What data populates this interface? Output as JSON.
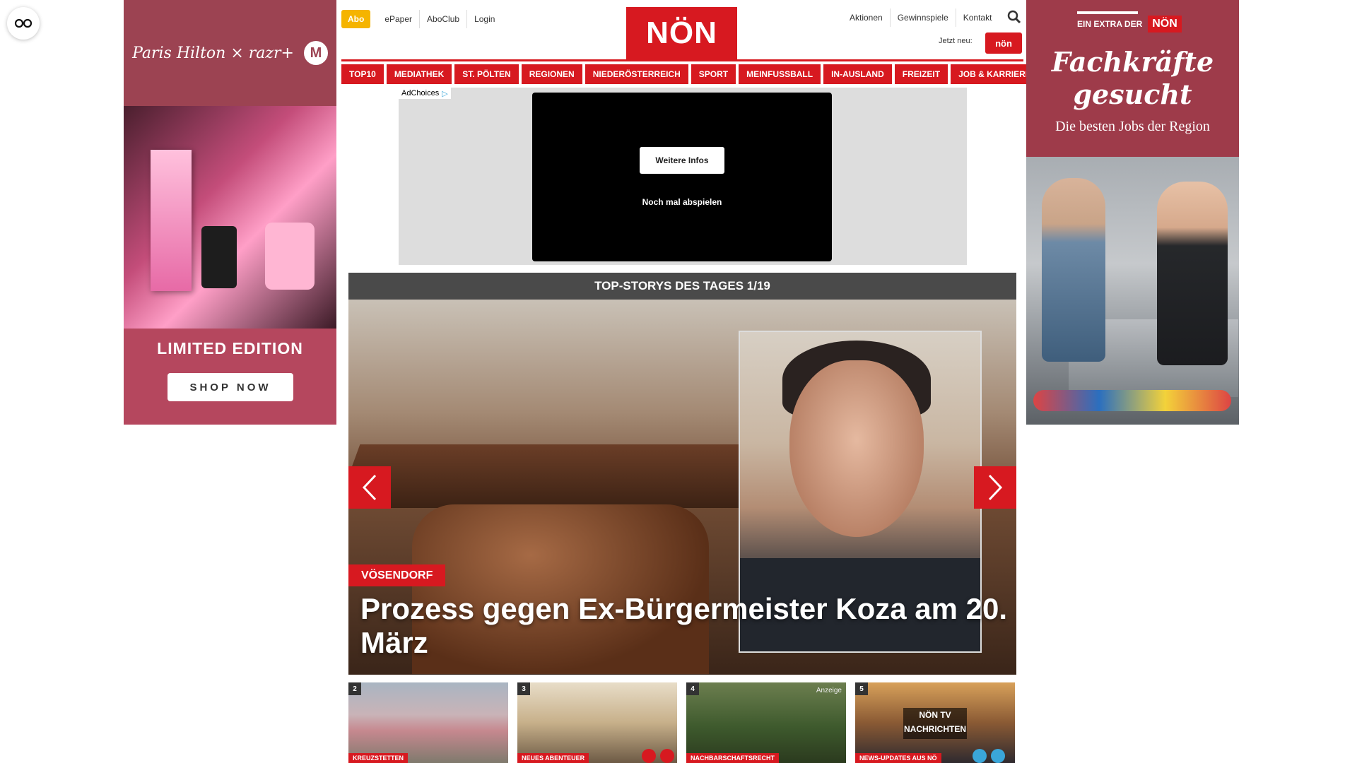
{
  "colors": {
    "brand_red": "#d71920",
    "abo_yellow": "#f5b400",
    "dark_header": "#4a4a4a"
  },
  "privacy_button": {
    "icon": "glasses-icon"
  },
  "ad_left": {
    "brand_text": "Paris Hilton × razr+",
    "headline": "LIMITED EDITION",
    "cta": "SHOP NOW"
  },
  "header": {
    "logo": "NÖN",
    "left_links": {
      "abo": "Abo",
      "epaper": "ePaper",
      "aboclub": "AboClub",
      "login": "Login"
    },
    "right_links": {
      "aktionen": "Aktionen",
      "gewinnspiele": "Gewinnspiele",
      "kontakt": "Kontakt"
    },
    "jetzt_neu": "Jetzt neu:",
    "meinenoen": "nön"
  },
  "nav": {
    "items": [
      "TOP10",
      "MEDIATHEK",
      "ST. PÖLTEN",
      "REGIONEN",
      "NIEDERÖSTERREICH",
      "SPORT",
      "MEINFUSSBALL",
      "IN-AUSLAND",
      "FREIZEIT",
      "JOB & KARRIERE"
    ]
  },
  "video_ad": {
    "adchoices": "AdChoices",
    "more_info": "Weitere Infos",
    "replay": "Noch mal abspielen"
  },
  "top_stories": {
    "heading": "TOP-STORYS DES TAGES 1/19",
    "hero": {
      "tag": "VÖSENDORF",
      "title": "Prozess gegen Ex-Bürgermeister Koza am 20. März"
    },
    "thumbs": [
      {
        "num": "2",
        "tag": "KREUZSTETTEN"
      },
      {
        "num": "3",
        "tag": "NEUES ABENTEUER"
      },
      {
        "num": "4",
        "tag": "NACHBARSCHAFTSRECHT",
        "badge": "Anzeige"
      },
      {
        "num": "5",
        "tag": "NEWS-UPDATES AUS NÖ",
        "overlay_title": "NÖN TV",
        "overlay_sub": "NACHRICHTEN"
      }
    ]
  },
  "ad_right": {
    "extra": "EIN EXTRA DER",
    "extra_logo": "NÖN",
    "headline": "Fachkräfte gesucht",
    "subline": "Die besten Jobs der Region"
  }
}
